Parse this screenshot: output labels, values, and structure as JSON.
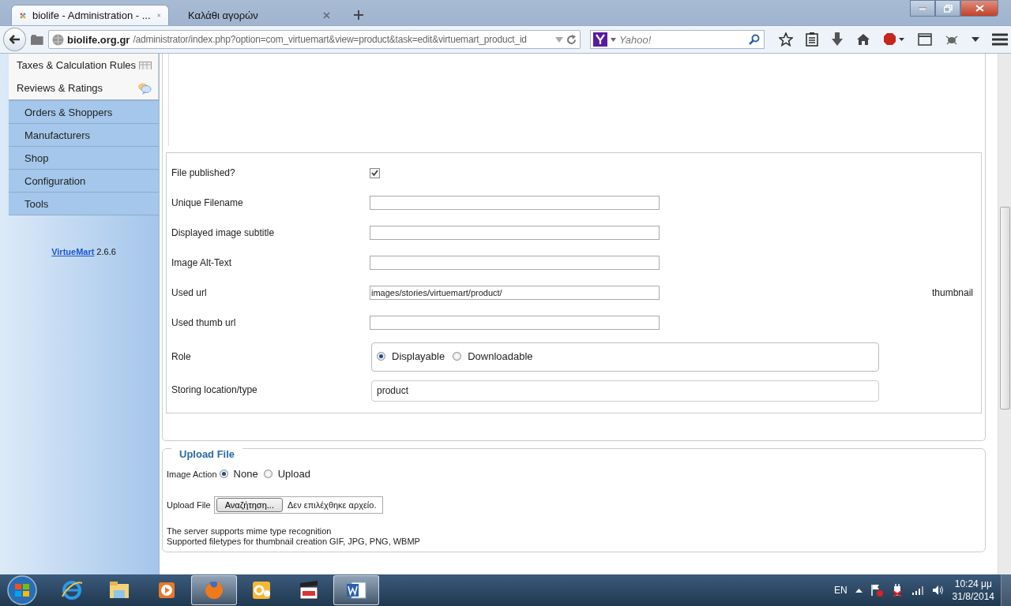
{
  "browser": {
    "tabs": [
      {
        "title": "biolife - Administration - ...",
        "selected": true
      },
      {
        "title": "Καλάθι αγορών",
        "selected": false
      }
    ],
    "url": {
      "host": "biolife.org.gr",
      "path": "/administrator/index.php?option=com_virtuemart&view=product&task=edit&virtuemart_product_id"
    },
    "search": {
      "placeholder": "Yahoo!"
    }
  },
  "sidebar": {
    "items": [
      {
        "label": "Taxes & Calculation Rules",
        "kind": "plain"
      },
      {
        "label": "Reviews & Ratings",
        "kind": "plain"
      },
      {
        "label": "Orders & Shoppers",
        "kind": "section"
      },
      {
        "label": "Manufacturers",
        "kind": "section"
      },
      {
        "label": "Shop",
        "kind": "section"
      },
      {
        "label": "Configuration",
        "kind": "section"
      },
      {
        "label": "Tools",
        "kind": "section"
      }
    ],
    "version_link": "VirtueMart",
    "version": "2.6.6"
  },
  "form": {
    "fields": [
      {
        "label": "File published?",
        "kind": "checkbox",
        "checked": true
      },
      {
        "label": "Unique Filename",
        "kind": "text"
      },
      {
        "label": "Displayed image subtitle",
        "kind": "text"
      },
      {
        "label": "Image Alt-Text",
        "kind": "text"
      },
      {
        "label": "Used url",
        "kind": "text",
        "value": "images/stories/virtuemart/product/"
      },
      {
        "label": "Used thumb url",
        "kind": "text"
      },
      {
        "label": "Role",
        "kind": "radio",
        "options": [
          {
            "label": "Displayable",
            "selected": true
          },
          {
            "label": "Downloadable",
            "selected": false
          }
        ]
      },
      {
        "label": "Storing location/type",
        "kind": "static",
        "value": "product"
      }
    ],
    "side_label": "thumbnail"
  },
  "upload": {
    "legend": "Upload File",
    "action_label": "Image Action",
    "options": [
      {
        "label": "None",
        "selected": true
      },
      {
        "label": "Upload",
        "selected": false
      }
    ],
    "file_label": "Upload File",
    "browse_button": "Αναζήτηση...",
    "file_status": "Δεν επιλέχθηκε αρχείο.",
    "notes": [
      "The server supports mime type recognition",
      "Supported filetypes for thumbnail creation GIF, JPG, PNG, WBMP"
    ]
  },
  "taskbar": {
    "apps": [
      {
        "kind": "ie",
        "selected": false
      },
      {
        "kind": "folder",
        "selected": false
      },
      {
        "kind": "media",
        "selected": false
      },
      {
        "kind": "firefox",
        "selected": true
      },
      {
        "kind": "outlook",
        "selected": false
      },
      {
        "kind": "clapper",
        "selected": false
      },
      {
        "kind": "word",
        "selected": true
      }
    ],
    "language": "EN",
    "time": "10:24 μμ",
    "date": "31/8/2014"
  }
}
